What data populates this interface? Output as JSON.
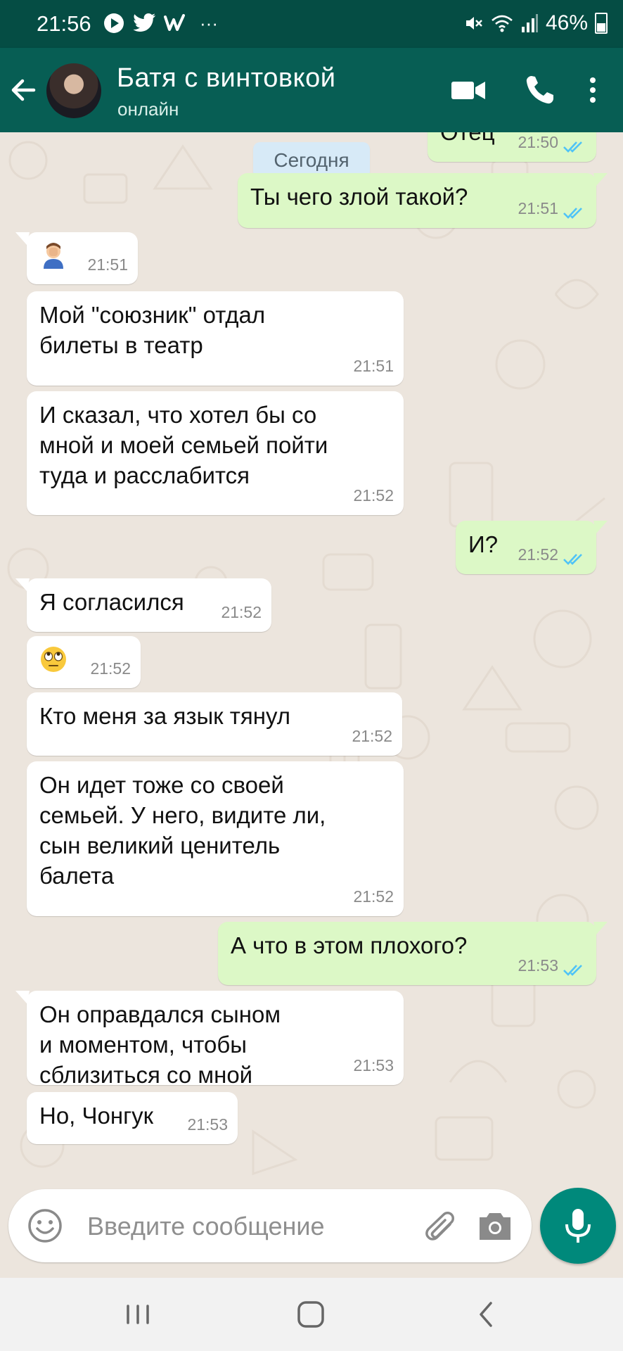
{
  "status_bar": {
    "time": "21:56",
    "more": "···",
    "battery": "46%"
  },
  "app_bar": {
    "contact_name": "Батя с винтовкой",
    "contact_status": "онлайн"
  },
  "date_chip": "Сегодня",
  "messages": [
    {
      "dir": "out",
      "text": "Отец",
      "time": "21:50",
      "read": true
    },
    {
      "dir": "out",
      "text": "Ты чего злой такой?",
      "time": "21:51",
      "read": true
    },
    {
      "dir": "in",
      "emoji": "facepalm-emoji",
      "time": "21:51"
    },
    {
      "dir": "in",
      "text": "Мой \"союзник\" отдал\nбилеты в театр",
      "time": "21:51"
    },
    {
      "dir": "in",
      "text": "И сказал, что хотел бы со\nмной и моей семьей пойти\nтуда и расслабится",
      "time": "21:52"
    },
    {
      "dir": "out",
      "text": "И?",
      "time": "21:52",
      "read": true
    },
    {
      "dir": "in",
      "text": "Я согласился",
      "time": "21:52"
    },
    {
      "dir": "in",
      "emoji": "eye-roll-emoji",
      "time": "21:52"
    },
    {
      "dir": "in",
      "text": "Кто меня за язык тянул",
      "time": "21:52"
    },
    {
      "dir": "in",
      "text": "Он идет тоже со своей\nсемьей. У него, видите ли,\nсын великий ценитель\nбалета",
      "time": "21:52"
    },
    {
      "dir": "out",
      "text": "А что в этом плохого?",
      "time": "21:53",
      "read": true
    },
    {
      "dir": "in",
      "text": "Он оправдался сыном\nи моментом, чтобы\nсблизиться со мной",
      "time": "21:53"
    },
    {
      "dir": "in",
      "text": "Но, Чонгук",
      "time": "21:53"
    }
  ],
  "input": {
    "placeholder": "Введите сообщение"
  },
  "colors": {
    "status_bar": "#054d44",
    "app_bar": "#075e54",
    "outgoing_bubble": "#dcf8c6",
    "incoming_bubble": "#ffffff",
    "chat_background": "#ece5dd",
    "read_ticks": "#4fc3f7",
    "mic_button": "#00897b"
  }
}
